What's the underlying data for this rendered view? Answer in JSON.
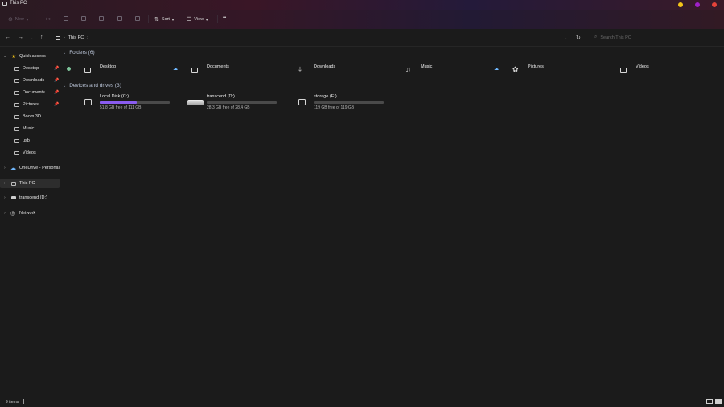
{
  "window": {
    "title": "This PC",
    "controls": {
      "yellow": "#f5c518",
      "purple": "#a020c8",
      "red": "#e8433a"
    }
  },
  "toolbar": {
    "new_label": "New",
    "sort_label": "Sort",
    "view_label": "View",
    "more_label": "•••"
  },
  "address": {
    "breadcrumb": "This PC",
    "search_placeholder": "Search This PC"
  },
  "sidebar": {
    "quick_access": "Quick access",
    "items": [
      {
        "label": "Desktop",
        "icon": "desktop-icon",
        "pinned": true
      },
      {
        "label": "Downloads",
        "icon": "download-icon",
        "pinned": true
      },
      {
        "label": "Documents",
        "icon": "document-icon",
        "pinned": true
      },
      {
        "label": "Pictures",
        "icon": "pictures-icon",
        "pinned": true
      },
      {
        "label": "Boom 3D",
        "icon": "folder-icon",
        "pinned": false
      },
      {
        "label": "Music",
        "icon": "music-icon",
        "pinned": false
      },
      {
        "label": "usb",
        "icon": "folder-icon",
        "pinned": false
      },
      {
        "label": "Videos",
        "icon": "videos-icon",
        "pinned": false
      }
    ],
    "onedrive": "OneDrive - Personal",
    "this_pc": "This PC",
    "transcend": "transcend (D:)",
    "network": "Network"
  },
  "folders": {
    "header": "Folders (6)",
    "items": [
      {
        "label": "Desktop",
        "icon": "desktop-icon"
      },
      {
        "label": "Documents",
        "icon": "document-icon"
      },
      {
        "label": "Downloads",
        "icon": "download-icon"
      },
      {
        "label": "Music",
        "icon": "music-icon"
      },
      {
        "label": "Pictures",
        "icon": "pictures-icon"
      },
      {
        "label": "Videos",
        "icon": "videos-icon"
      }
    ]
  },
  "drives": {
    "header": "Devices and drives (3)",
    "items": [
      {
        "name": "Local Disk (C:)",
        "free": "51.8 GB free of 111 GB",
        "used_fraction": 0.53,
        "icon": "drive-icon"
      },
      {
        "name": "transcend (D:)",
        "free": "28.3 GB free of 28.4 GB",
        "used_fraction": 0.0,
        "icon": "sd-card-icon"
      },
      {
        "name": "storage (E:)",
        "free": "119 GB free of 119 GB",
        "used_fraction": 0.0,
        "icon": "drive-icon"
      }
    ]
  },
  "status": {
    "items_count": "9 items"
  },
  "colors": {
    "accent": "#8a5cf0",
    "cloud": "#6fb8ff"
  }
}
